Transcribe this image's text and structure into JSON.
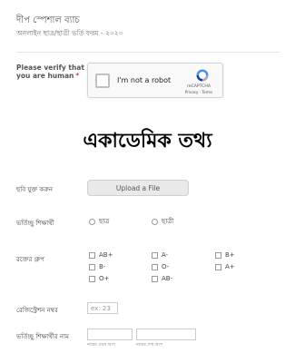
{
  "header": {
    "title": "দীপ স্পেশাল ব্যাচ",
    "subtitle": "অনলাইন ছাত্র/ছাত্রী ভর্তি ফরম - ২০২০"
  },
  "verify": {
    "label": "Please verify that you are human",
    "required_mark": "*",
    "captcha_text": "I'm not a robot",
    "captcha_brand": "reCAPTCHA",
    "captcha_links": "Privacy - Terms"
  },
  "section_title": "একাডেমিক তথ্য",
  "photo": {
    "label": "ছবি যুক্ত করুন",
    "button": "Upload a File"
  },
  "student_type": {
    "label": "ভর্তিচ্ছু শিক্ষার্থী",
    "options": [
      "ছাত্র",
      "ছাত্রী"
    ]
  },
  "blood_group": {
    "label": "রক্তের গ্রুপ",
    "options": [
      "AB+",
      "A-",
      "B+",
      "B-",
      "O-",
      "A+",
      "O+",
      "AB-"
    ]
  },
  "registration": {
    "label": "রেজিস্ট্রেশন নম্বর",
    "placeholder": "ex: 23"
  },
  "student_name": {
    "label": "ভর্তিচ্ছু শিক্ষার্থীর নাম",
    "first_hint": "নামের প্রথম অংশ",
    "last_hint": "নামের শেষ অংশ"
  },
  "colors": {
    "required": "#cc0000",
    "recaptcha_blue": "#4a90e2"
  }
}
